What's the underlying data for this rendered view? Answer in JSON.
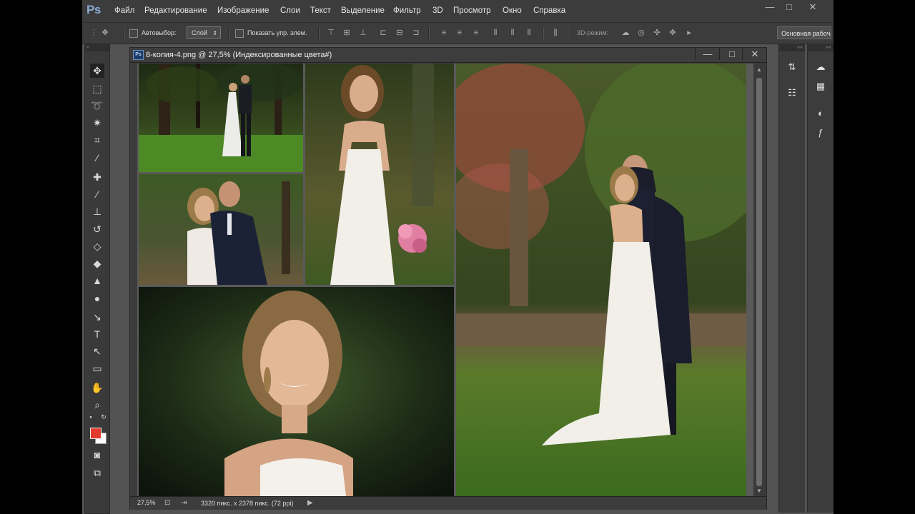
{
  "app": {
    "logo": "Ps"
  },
  "menu": [
    "Файл",
    "Редактирование",
    "Изображение",
    "Слои",
    "Текст",
    "Выделение",
    "Фильтр",
    "3D",
    "Просмотр",
    "Окно",
    "Справка"
  ],
  "window_controls": {
    "minimize": "—",
    "maximize": "□",
    "close": "✕"
  },
  "options": {
    "autoselect_label": "Автовыбор:",
    "autoselect_value": "Слой",
    "show_transform_label": "Показать упр. элем.",
    "mode3d_label": "3D-режим:",
    "workspace": "Основная рабочая среда"
  },
  "document": {
    "icon": "Ps",
    "title": "8-копия-4.png @ 27,5% (Индексированные цвета#)",
    "controls": {
      "minimize": "—",
      "maximize": "□",
      "close": "✕"
    }
  },
  "status": {
    "zoom": "27,5%",
    "info": "3320 пикс. x 2378 пикс. (72 ppi)",
    "arrow": "▶"
  },
  "colors": {
    "foreground": "#e23b2e",
    "background": "#ffffff"
  },
  "tools": [
    "move-icon",
    "marquee-icon",
    "lasso-icon",
    "magic-wand-icon",
    "crop-icon",
    "eyedropper-icon",
    "healing-brush-icon",
    "brush-icon",
    "clone-stamp-icon",
    "history-brush-icon",
    "eraser-icon",
    "paint-bucket-icon",
    "blur-icon",
    "dodge-icon",
    "pen-icon",
    "type-icon",
    "path-selection-icon",
    "rectangle-icon",
    "hand-icon",
    "zoom-icon"
  ],
  "tool_glyphs": {
    "type": "T"
  }
}
